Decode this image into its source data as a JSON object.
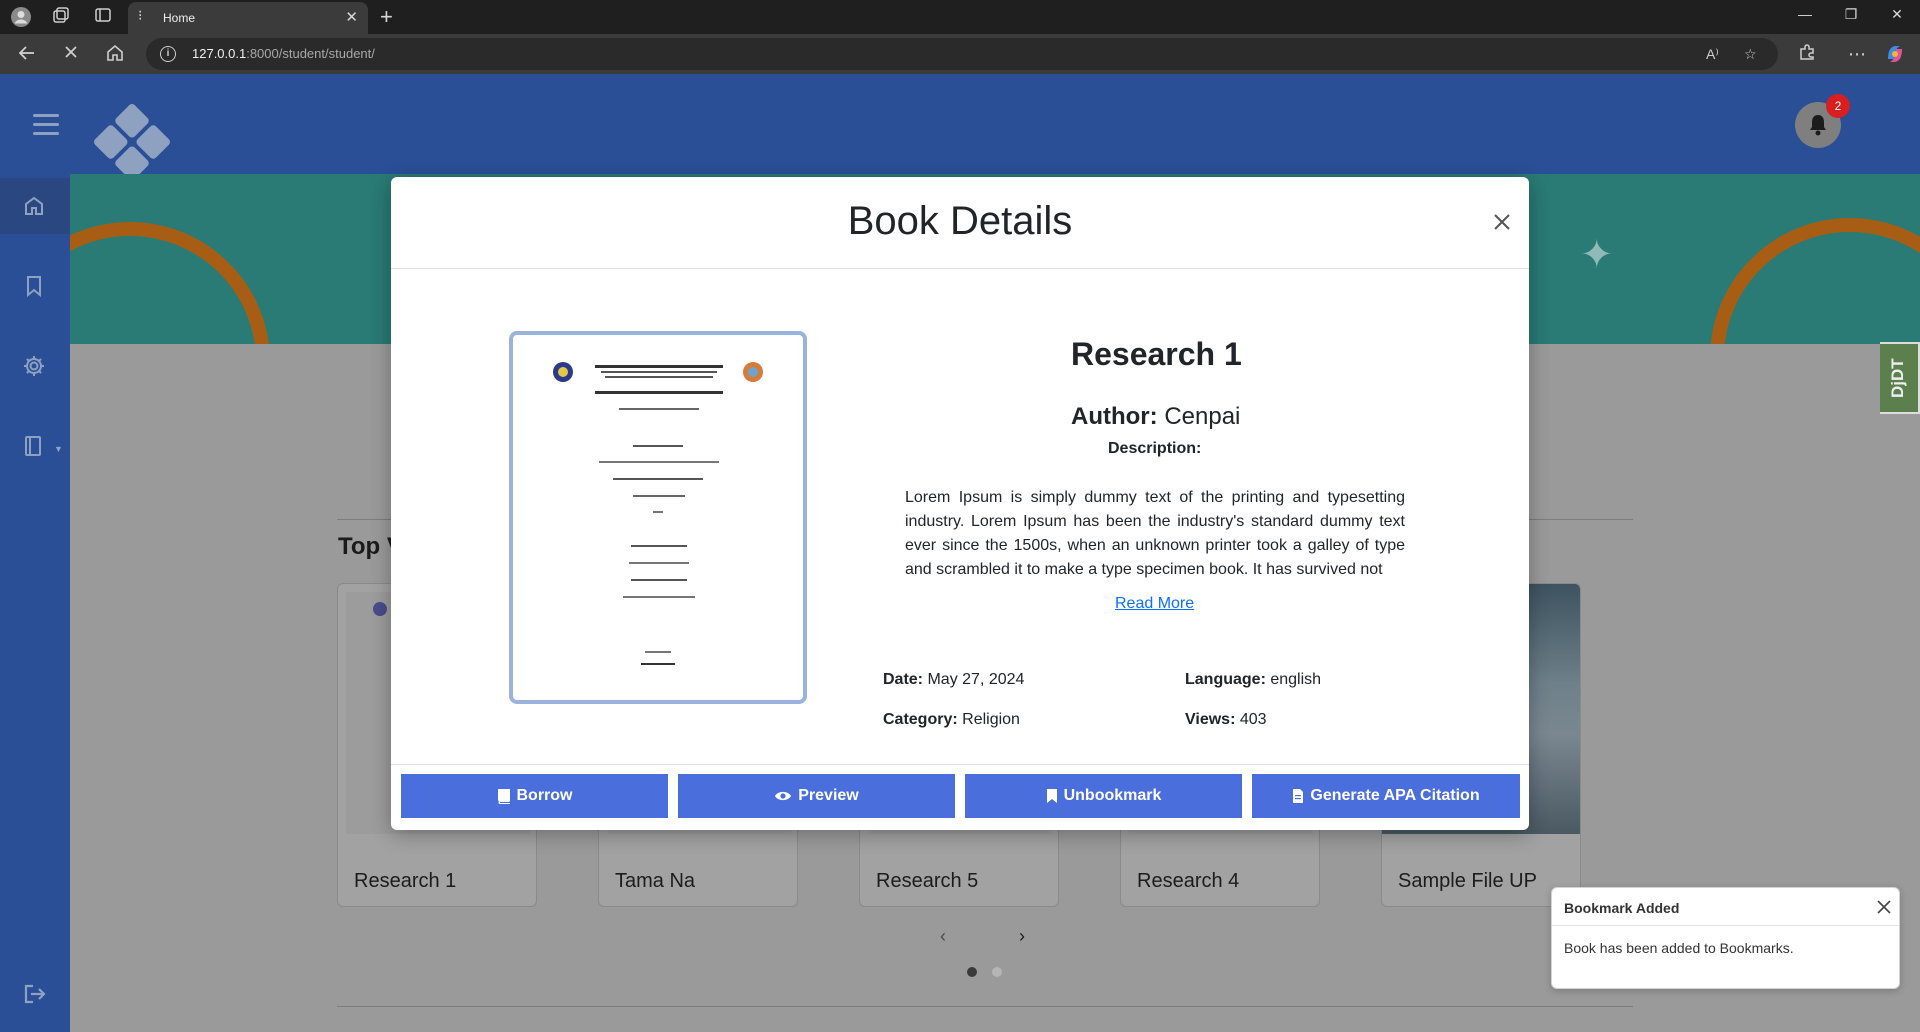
{
  "browser": {
    "tab_title": "Home",
    "url_host": "127.0.0.1",
    "url_path": ":8000/student/student/"
  },
  "notifications": {
    "count": "2"
  },
  "side_badge": "DjDT",
  "main": {
    "section_heading": "Top V",
    "cards": [
      {
        "title": "Research 1"
      },
      {
        "title": "Tama Na"
      },
      {
        "title": "Research 5"
      },
      {
        "title": "Research 4"
      },
      {
        "title": "Sample File UP"
      }
    ],
    "carousel": {
      "prev": "‹",
      "next": "›"
    }
  },
  "modal": {
    "title": "Book Details",
    "book_title": "Research 1",
    "author_label": "Author:",
    "author": "Cenpai",
    "description_label": "Description:",
    "description": "Lorem Ipsum is simply dummy text of the printing and typesetting industry. Lorem Ipsum has been the industry's standard dummy text ever since the 1500s, when an unknown printer took a galley of type and scrambled it to make a type specimen book. It has survived not",
    "read_more": "Read More",
    "date_label": "Date:",
    "date": "May 27, 2024",
    "language_label": "Language:",
    "language": "english",
    "category_label": "Category:",
    "category": "Religion",
    "views_label": "Views:",
    "views": "403",
    "buttons": {
      "borrow": "Borrow",
      "preview": "Preview",
      "unbookmark": "Unbookmark",
      "citation": "Generate APA Citation"
    }
  },
  "toast": {
    "title": "Bookmark Added",
    "body": "Book has been added to Bookmarks."
  },
  "colors": {
    "header": "#2a4f97",
    "button": "#4a6fdc",
    "link": "#0d6efd",
    "badge": "#d81e1e"
  }
}
